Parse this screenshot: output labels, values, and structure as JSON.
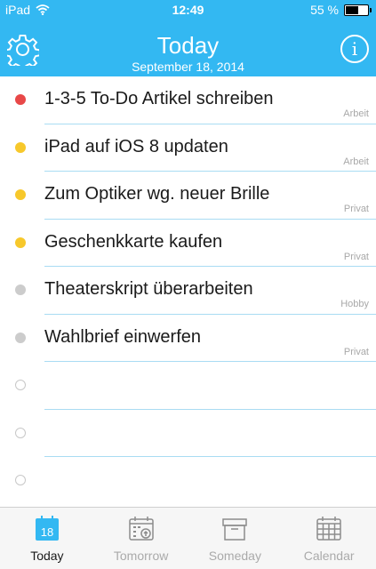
{
  "status_bar": {
    "device": "iPad",
    "time": "12:49",
    "battery": "55 %"
  },
  "header": {
    "title": "Today",
    "date": "September 18, 2014"
  },
  "tasks": [
    {
      "label": "1-3-5 To-Do Artikel schreiben",
      "tag": "Arbeit",
      "color": "#e84848",
      "filled": true
    },
    {
      "label": "iPad auf iOS 8 updaten",
      "tag": "Arbeit",
      "color": "#f7c82b",
      "filled": true
    },
    {
      "label": "Zum Optiker wg. neuer Brille",
      "tag": "Privat",
      "color": "#f7c82b",
      "filled": true
    },
    {
      "label": "Geschenkkarte kaufen",
      "tag": "Privat",
      "color": "#f7c82b",
      "filled": true
    },
    {
      "label": "Theaterskript überarbeiten",
      "tag": "Hobby",
      "color": "#cccccc",
      "filled": true
    },
    {
      "label": "Wahlbrief einwerfen",
      "tag": "Privat",
      "color": "#cccccc",
      "filled": true
    },
    {
      "label": "",
      "tag": "",
      "color": "#c8c8c8",
      "filled": false
    },
    {
      "label": "",
      "tag": "",
      "color": "#c8c8c8",
      "filled": false
    },
    {
      "label": "",
      "tag": "",
      "color": "#c8c8c8",
      "filled": false
    }
  ],
  "tabs": [
    {
      "label": "Today",
      "icon": "calendar-day-icon",
      "badge": "18",
      "active": true
    },
    {
      "label": "Tomorrow",
      "icon": "tomorrow-icon",
      "active": false
    },
    {
      "label": "Someday",
      "icon": "archive-box-icon",
      "active": false
    },
    {
      "label": "Calendar",
      "icon": "calendar-grid-icon",
      "active": false
    }
  ],
  "colors": {
    "accent": "#33b8f2",
    "separator": "#a9dcf3"
  }
}
